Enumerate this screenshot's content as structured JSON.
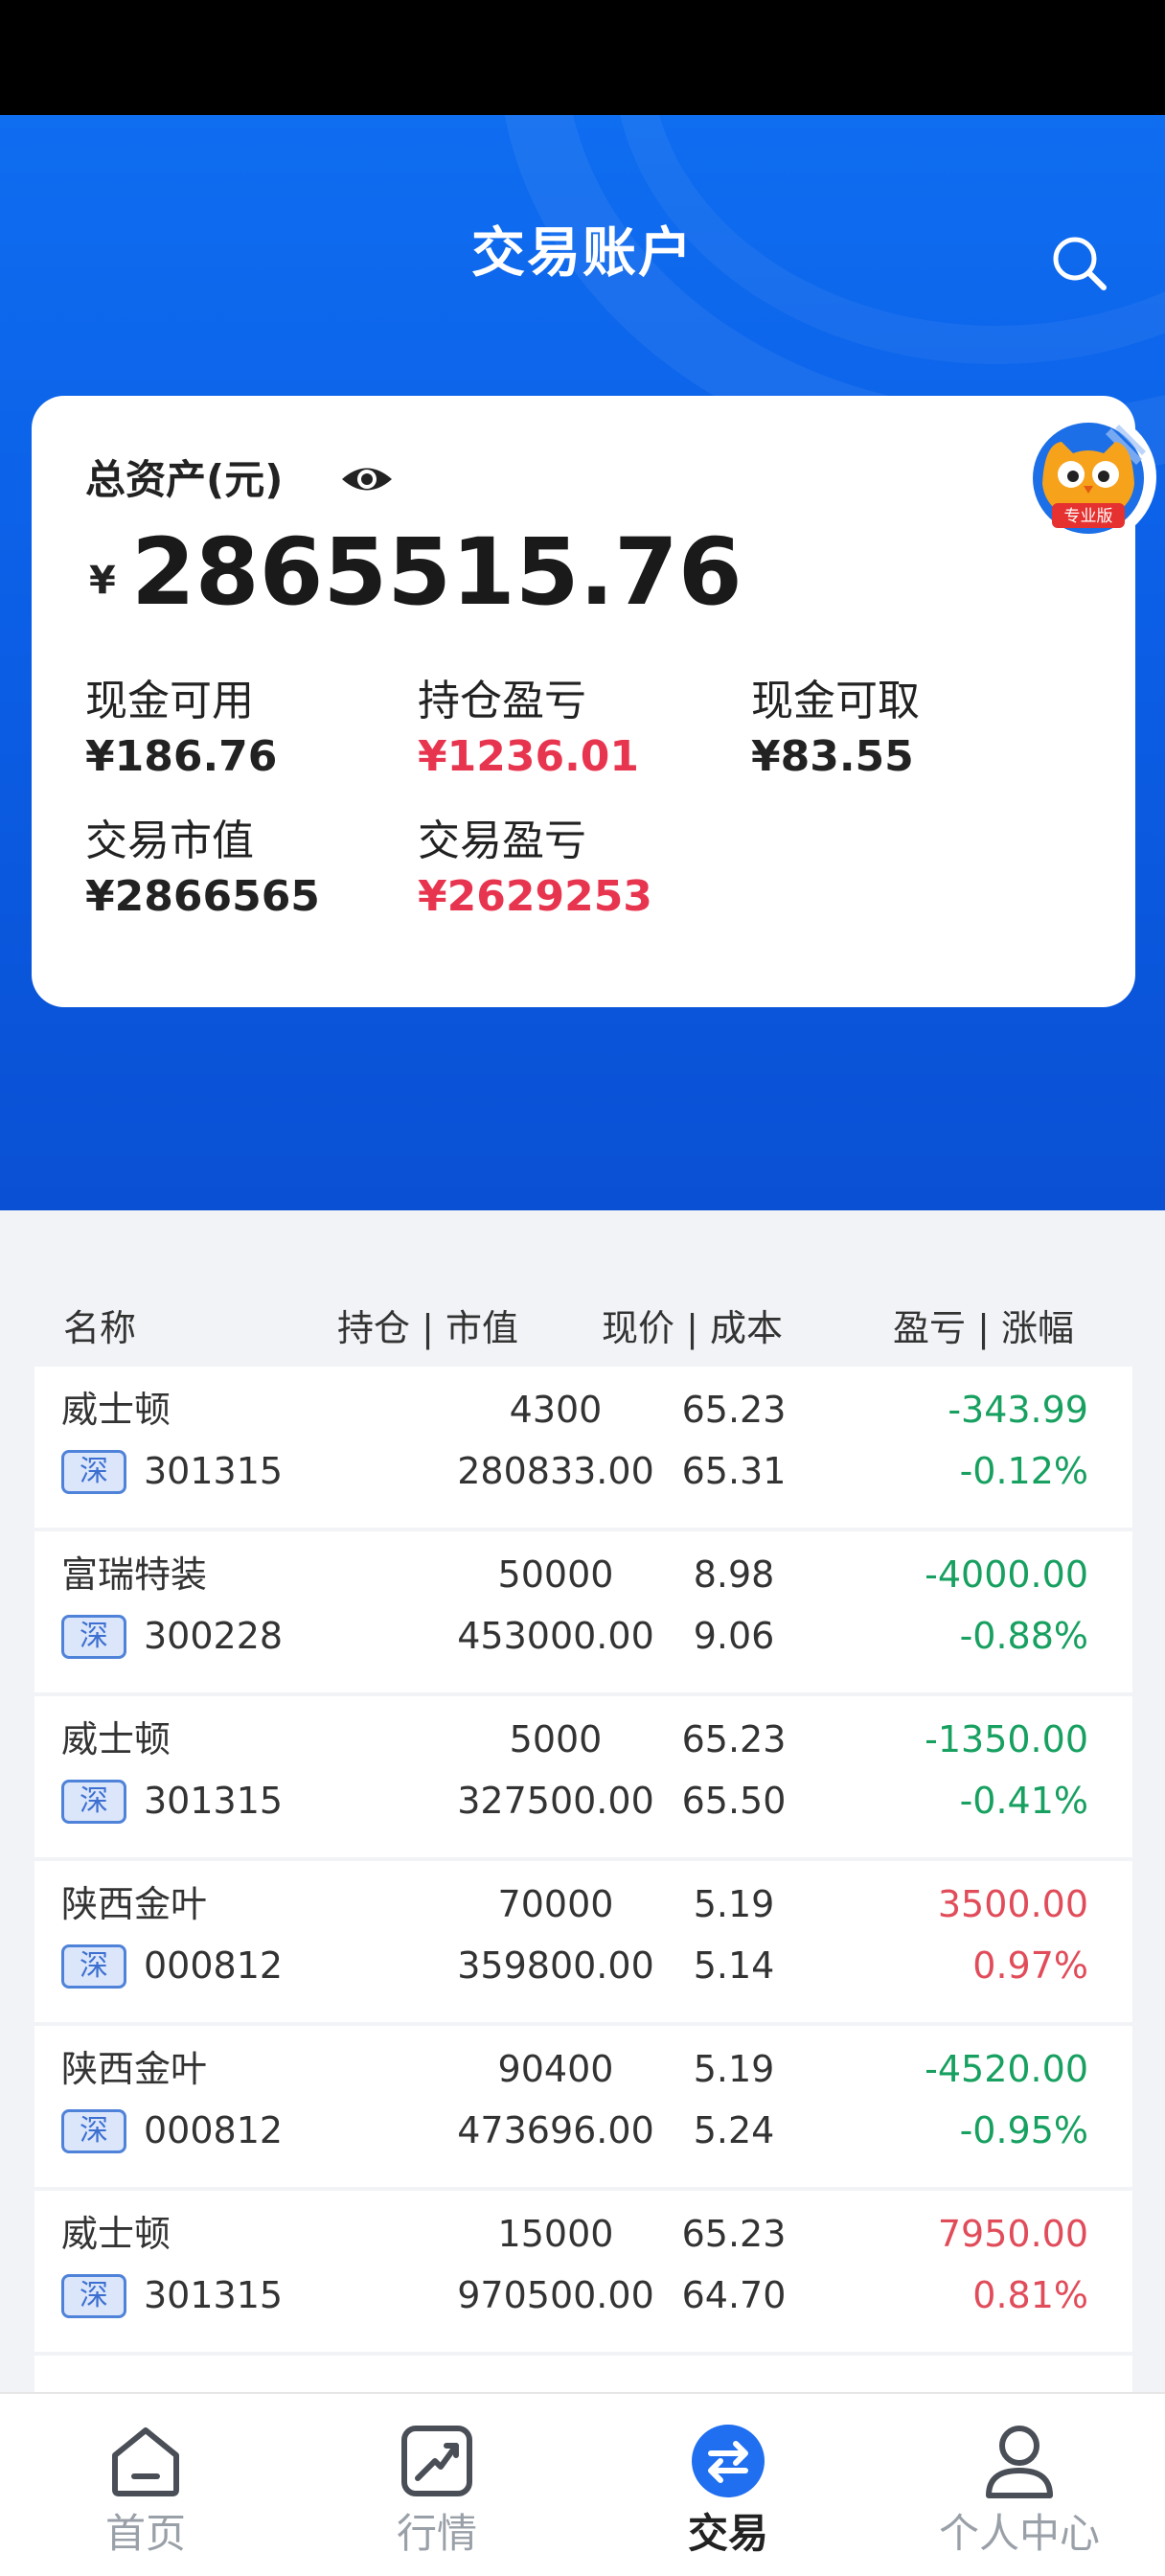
{
  "header": {
    "title": "交易账户"
  },
  "account": {
    "total_label": "总资产(元)",
    "currency": "¥",
    "total_value": "2865515.76",
    "badge_text": "专业版",
    "stats": {
      "cash_available": {
        "label": "现金可用",
        "value": "¥186.76"
      },
      "position_pnl": {
        "label": "持仓盈亏",
        "value": "¥1236.01"
      },
      "cash_withdrawable": {
        "label": "现金可取",
        "value": "¥83.55"
      },
      "market_value": {
        "label": "交易市值",
        "value": "¥2866565"
      },
      "trade_pnl": {
        "label": "交易盈亏",
        "value": "¥2629253"
      }
    }
  },
  "table": {
    "headers": {
      "name": "名称",
      "position": "持仓 | 市值",
      "price": "现价 | 成本",
      "pnl": "盈亏 | 涨幅"
    },
    "rows": [
      {
        "name": "威士顿",
        "market": "深",
        "code": "301315",
        "qty": "4300",
        "market_value": "280833.00",
        "price": "65.23",
        "cost": "65.31",
        "pnl": "-343.99",
        "pct": "-0.12%",
        "trend": "down"
      },
      {
        "name": "富瑞特装",
        "market": "深",
        "code": "300228",
        "qty": "50000",
        "market_value": "453000.00",
        "price": "8.98",
        "cost": "9.06",
        "pnl": "-4000.00",
        "pct": "-0.88%",
        "trend": "down"
      },
      {
        "name": "威士顿",
        "market": "深",
        "code": "301315",
        "qty": "5000",
        "market_value": "327500.00",
        "price": "65.23",
        "cost": "65.50",
        "pnl": "-1350.00",
        "pct": "-0.41%",
        "trend": "down"
      },
      {
        "name": "陕西金叶",
        "market": "深",
        "code": "000812",
        "qty": "70000",
        "market_value": "359800.00",
        "price": "5.19",
        "cost": "5.14",
        "pnl": "3500.00",
        "pct": "0.97%",
        "trend": "up"
      },
      {
        "name": "陕西金叶",
        "market": "深",
        "code": "000812",
        "qty": "90400",
        "market_value": "473696.00",
        "price": "5.19",
        "cost": "5.24",
        "pnl": "-4520.00",
        "pct": "-0.95%",
        "trend": "down"
      },
      {
        "name": "威士顿",
        "market": "深",
        "code": "301315",
        "qty": "15000",
        "market_value": "970500.00",
        "price": "65.23",
        "cost": "64.70",
        "pnl": "7950.00",
        "pct": "0.81%",
        "trend": "up"
      }
    ]
  },
  "tabs": [
    {
      "label": "首页",
      "icon": "home-icon",
      "active": false
    },
    {
      "label": "行情",
      "icon": "chart-icon",
      "active": false
    },
    {
      "label": "交易",
      "icon": "exchange-icon",
      "active": true
    },
    {
      "label": "个人中心",
      "icon": "person-icon",
      "active": false
    }
  ],
  "colors": {
    "brand_blue": "#0f6df0",
    "loss_green": "#17a060",
    "gain_red": "#e14c5a",
    "highlight_red": "#e8354f"
  }
}
